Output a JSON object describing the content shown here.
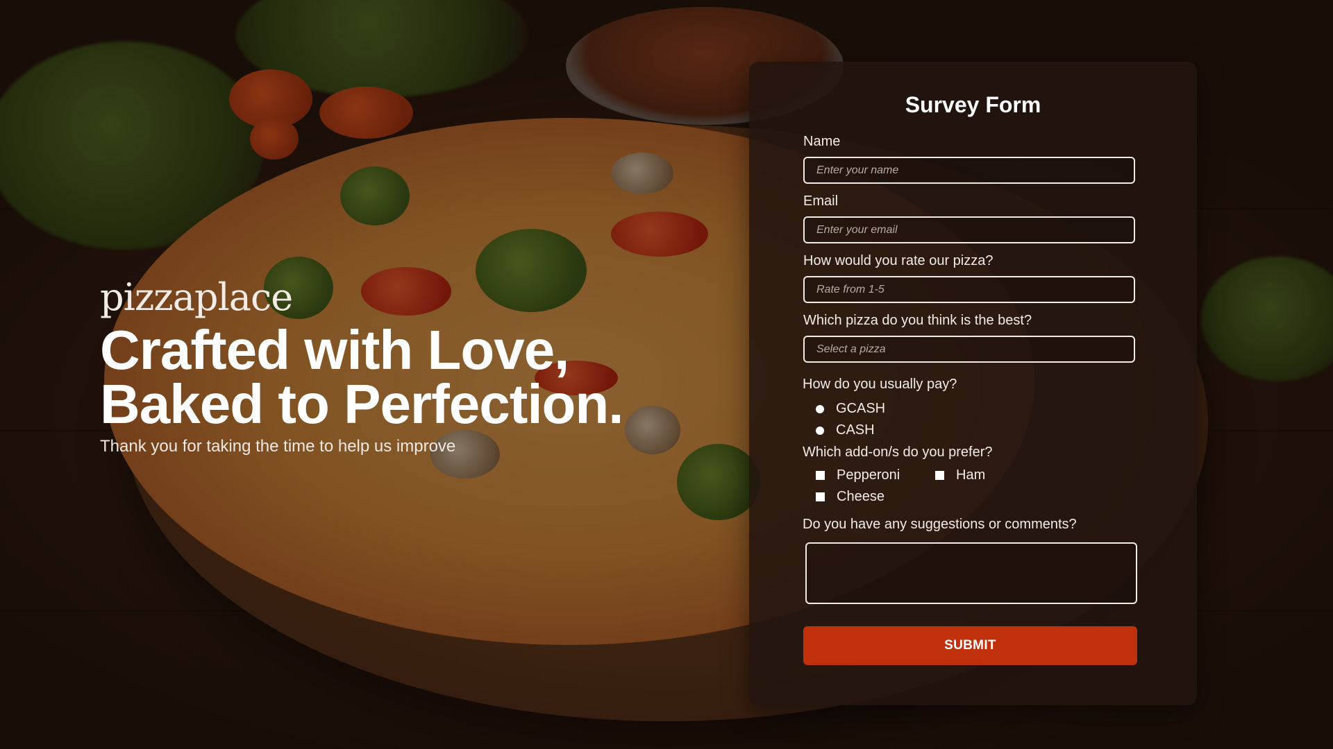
{
  "hero": {
    "brand": "pizzaplace",
    "headline_line1": "Crafted with Love,",
    "headline_line2": "Baked to Perfection.",
    "subline": "Thank you for taking the time to help us improve"
  },
  "form": {
    "title": "Survey Form",
    "name": {
      "label": "Name",
      "placeholder": "Enter your name",
      "value": ""
    },
    "email": {
      "label": "Email",
      "placeholder": "Enter your email",
      "value": ""
    },
    "rating": {
      "label": "How would you rate our pizza?",
      "placeholder": "Rate from 1-5",
      "value": ""
    },
    "best_pizza": {
      "label": "Which pizza do you think is the best?",
      "selected": "Select a pizza"
    },
    "payment": {
      "label": "How do you usually pay?",
      "options": [
        "GCASH",
        "CASH"
      ]
    },
    "addons": {
      "label": "Which add-on/s do you prefer?",
      "options": [
        "Pepperoni",
        "Ham",
        "Cheese"
      ]
    },
    "comments": {
      "label": "Do you have any suggestions or comments?",
      "value": ""
    },
    "submit_label": "SUBMIT"
  },
  "colors": {
    "accent": "#c0300a",
    "card_bg": "#22150f",
    "text": "#ffffff"
  }
}
